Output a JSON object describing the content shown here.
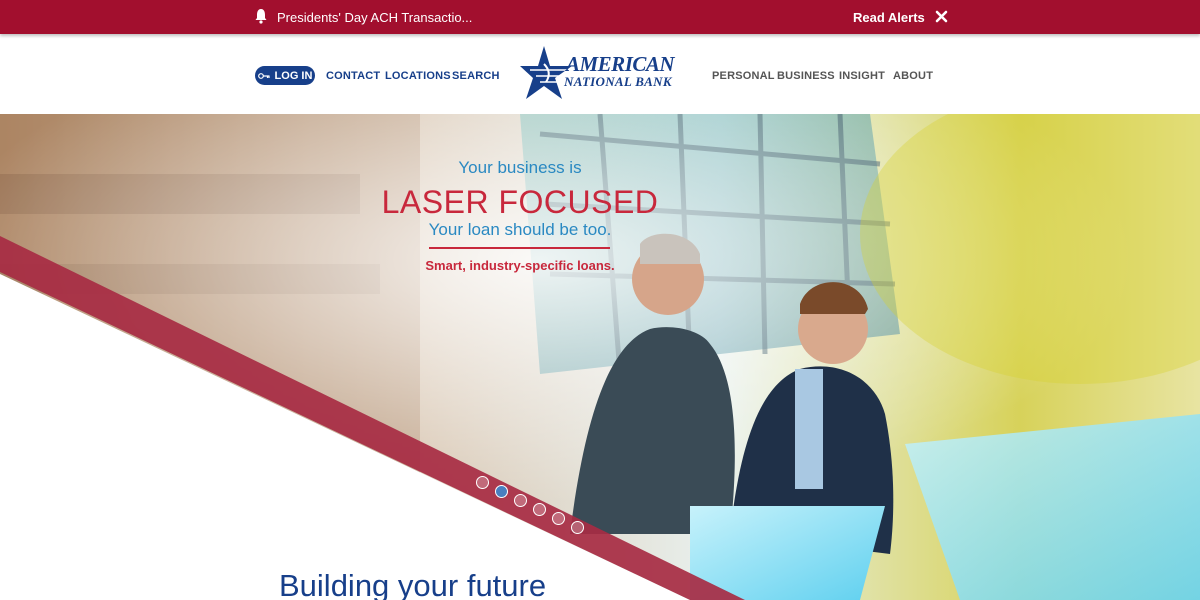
{
  "alert": {
    "text": "Presidents' Day ACH Transactio...",
    "read_label": "Read Alerts",
    "icon": "bell-icon",
    "close_icon": "close-icon"
  },
  "header": {
    "login_label": "LOG IN",
    "nav_left": [
      "CONTACT",
      "LOCATIONS",
      "SEARCH"
    ],
    "logo": {
      "line1": "AMERICAN",
      "line2": "NATIONAL BANK"
    },
    "nav_right": [
      "PERSONAL",
      "BUSINESS",
      "INSIGHT",
      "ABOUT"
    ]
  },
  "hero": {
    "line1": "Your business is",
    "line2": "LASER FOCUSED",
    "line3": "Your loan should be too.",
    "line4": "Smart, industry-specific loans.",
    "slides_total": 6,
    "active_slide": 2
  },
  "section": {
    "heading": "Building your future"
  },
  "colors": {
    "brand_red": "#a20f2e",
    "brand_blue": "#173f8a",
    "accent_blue": "#2a89c2",
    "accent_red": "#c8283c"
  }
}
